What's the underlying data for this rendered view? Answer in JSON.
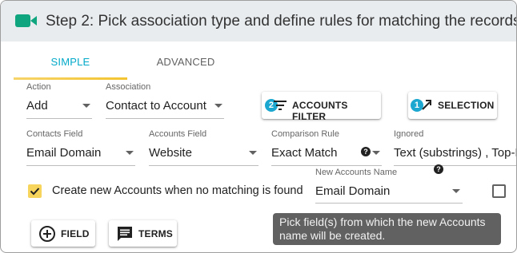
{
  "header": {
    "title": "Step 2: Pick association type and define rules for matching the records.",
    "icon": "video-camera-icon",
    "accent": "#0fa57f"
  },
  "tabs": [
    {
      "label": "SIMPLE",
      "active": true
    },
    {
      "label": "ADVANCED",
      "active": false
    }
  ],
  "colors": {
    "tab_active": "#03a9c9",
    "ink": "#f4c430",
    "badge": "#1ba7cf",
    "tooltip_bg": "#616161"
  },
  "action": {
    "label": "Action",
    "value": "Add"
  },
  "association": {
    "label": "Association",
    "value": "Contact to Account"
  },
  "accounts_filter": {
    "label": "ACCOUNTS FILTER",
    "badge": "2",
    "icon": "filter-list-icon"
  },
  "selection": {
    "label": "SELECTION",
    "badge": "1",
    "icon": "selection-arrow-icon"
  },
  "contacts_field": {
    "label": "Contacts Field",
    "value": "Email Domain"
  },
  "accounts_field": {
    "label": "Accounts Field",
    "value": "Website"
  },
  "comparison_rule": {
    "label": "Comparison Rule",
    "value": "Exact Match",
    "help": "?"
  },
  "ignored": {
    "label": "Ignored",
    "value": "Text (substrings) , Top-L"
  },
  "create_new": {
    "label": "Create new Accounts when no matching is found",
    "checked": true
  },
  "new_accounts_name": {
    "label": "New Accounts Name",
    "value": "Email Domain",
    "help": "?"
  },
  "extra_checkbox": {
    "checked": false
  },
  "buttons": {
    "field": {
      "label": "FIELD",
      "icon": "add-circle-icon"
    },
    "terms": {
      "label": "TERMS",
      "icon": "comment-icon"
    }
  },
  "tooltip": {
    "text": "Pick field(s) from which the new Accounts name will be created."
  }
}
